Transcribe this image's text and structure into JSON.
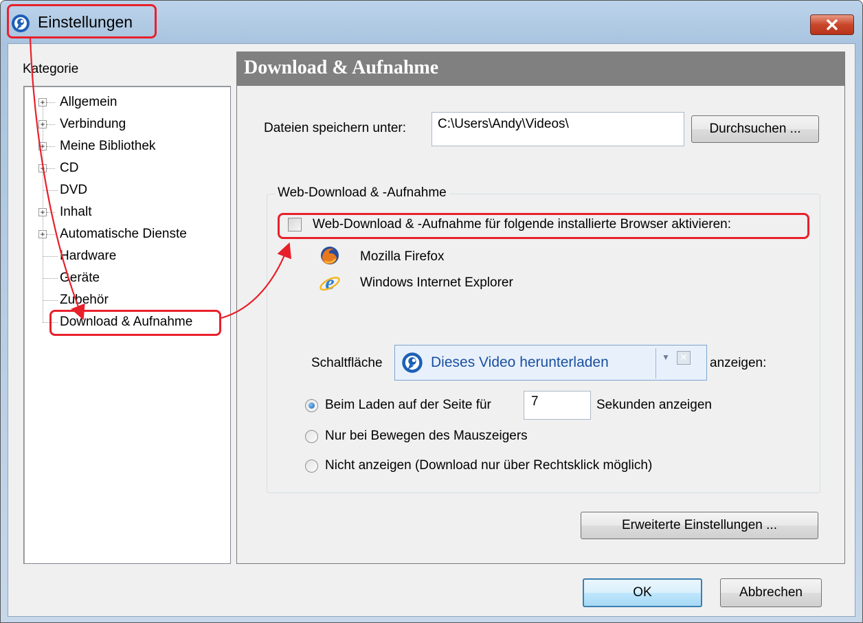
{
  "window": {
    "title": "Einstellungen",
    "close_symbol": "✕"
  },
  "sidebar": {
    "label": "Kategorie",
    "items": [
      {
        "label": "Allgemein",
        "expandable": true
      },
      {
        "label": "Verbindung",
        "expandable": true
      },
      {
        "label": "Meine Bibliothek",
        "expandable": true
      },
      {
        "label": "CD",
        "expandable": true
      },
      {
        "label": "DVD",
        "expandable": false
      },
      {
        "label": "Inhalt",
        "expandable": true
      },
      {
        "label": "Automatische Dienste",
        "expandable": true
      },
      {
        "label": "Hardware",
        "expandable": false
      },
      {
        "label": "Geräte",
        "expandable": false
      },
      {
        "label": "Zubehör",
        "expandable": false
      },
      {
        "label": "Download & Aufnahme",
        "expandable": false,
        "selected": true
      }
    ]
  },
  "panel": {
    "title": "Download & Aufnahme",
    "save_label": "Dateien speichern unter:",
    "save_path": "C:\\Users\\Andy\\Videos\\",
    "browse_button": "Durchsuchen ...",
    "group_title": "Web-Download & -Aufnahme",
    "enable_checkbox_label": "Web-Download & -Aufnahme für folgende installierte Browser aktivieren:",
    "enable_checked": false,
    "browsers": [
      {
        "name": "Mozilla Firefox",
        "icon": "firefox-icon"
      },
      {
        "name": "Windows Internet Explorer",
        "icon": "internet-explorer-icon"
      }
    ],
    "button_prefix": "Schaltfläche",
    "button_suffix": "anzeigen:",
    "download_widget_label": "Dieses Video herunterladen",
    "radio_options": [
      {
        "label": "Beim Laden auf der Seite für",
        "checked": true
      },
      {
        "label": "Nur bei Bewegen des Mauszeigers",
        "checked": false
      },
      {
        "label": "Nicht anzeigen (Download nur über Rechtsklick möglich)",
        "checked": false
      }
    ],
    "seconds_value": "7",
    "seconds_suffix": "Sekunden anzeigen",
    "advanced_button": "Erweiterte Einstellungen ..."
  },
  "footer": {
    "ok_button": "OK",
    "cancel_button": "Abbrechen"
  },
  "colors": {
    "annotation_red": "#e8202a",
    "header_gray": "#808080"
  }
}
